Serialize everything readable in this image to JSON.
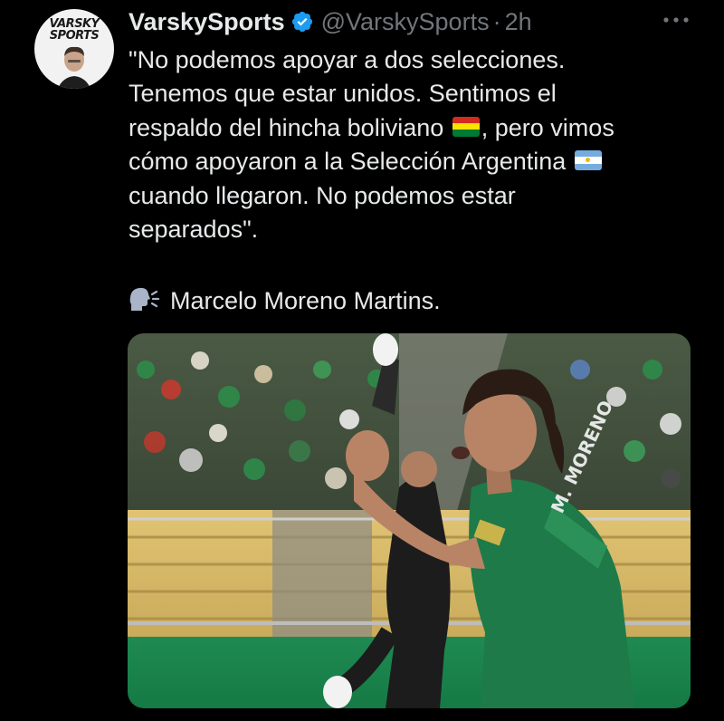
{
  "tweet": {
    "avatar": {
      "logo_line1": "VARSKY",
      "logo_line2": "SPORTS"
    },
    "display_name": "VarskySports",
    "verified": true,
    "handle": "@VarskySports",
    "separator": "·",
    "timestamp": "2h",
    "text_lines": [
      "\"No podemos apoyar a dos selecciones.",
      "Tenemos que estar unidos. Sentimos el",
      "respaldo del hincha boliviano",
      ", pero vimos",
      "cómo apoyaron a la Selección Argentina",
      "cuando llegaron. No podemos estar",
      "separados\"."
    ],
    "speaker_line": "Marcelo Moreno Martins.",
    "icons": {
      "more": "more-horizontal-icon",
      "verified": "verified-badge-icon",
      "speaker": "speaking-head-icon",
      "flag_bolivia": "bolivia-flag-icon",
      "flag_argentina": "argentina-flag-icon"
    },
    "colors": {
      "background": "#000000",
      "text": "#e7e9ea",
      "muted": "#71767b",
      "verified_blue": "#1d9bf0"
    },
    "media": {
      "jersey_text": "M. MORENO"
    }
  }
}
